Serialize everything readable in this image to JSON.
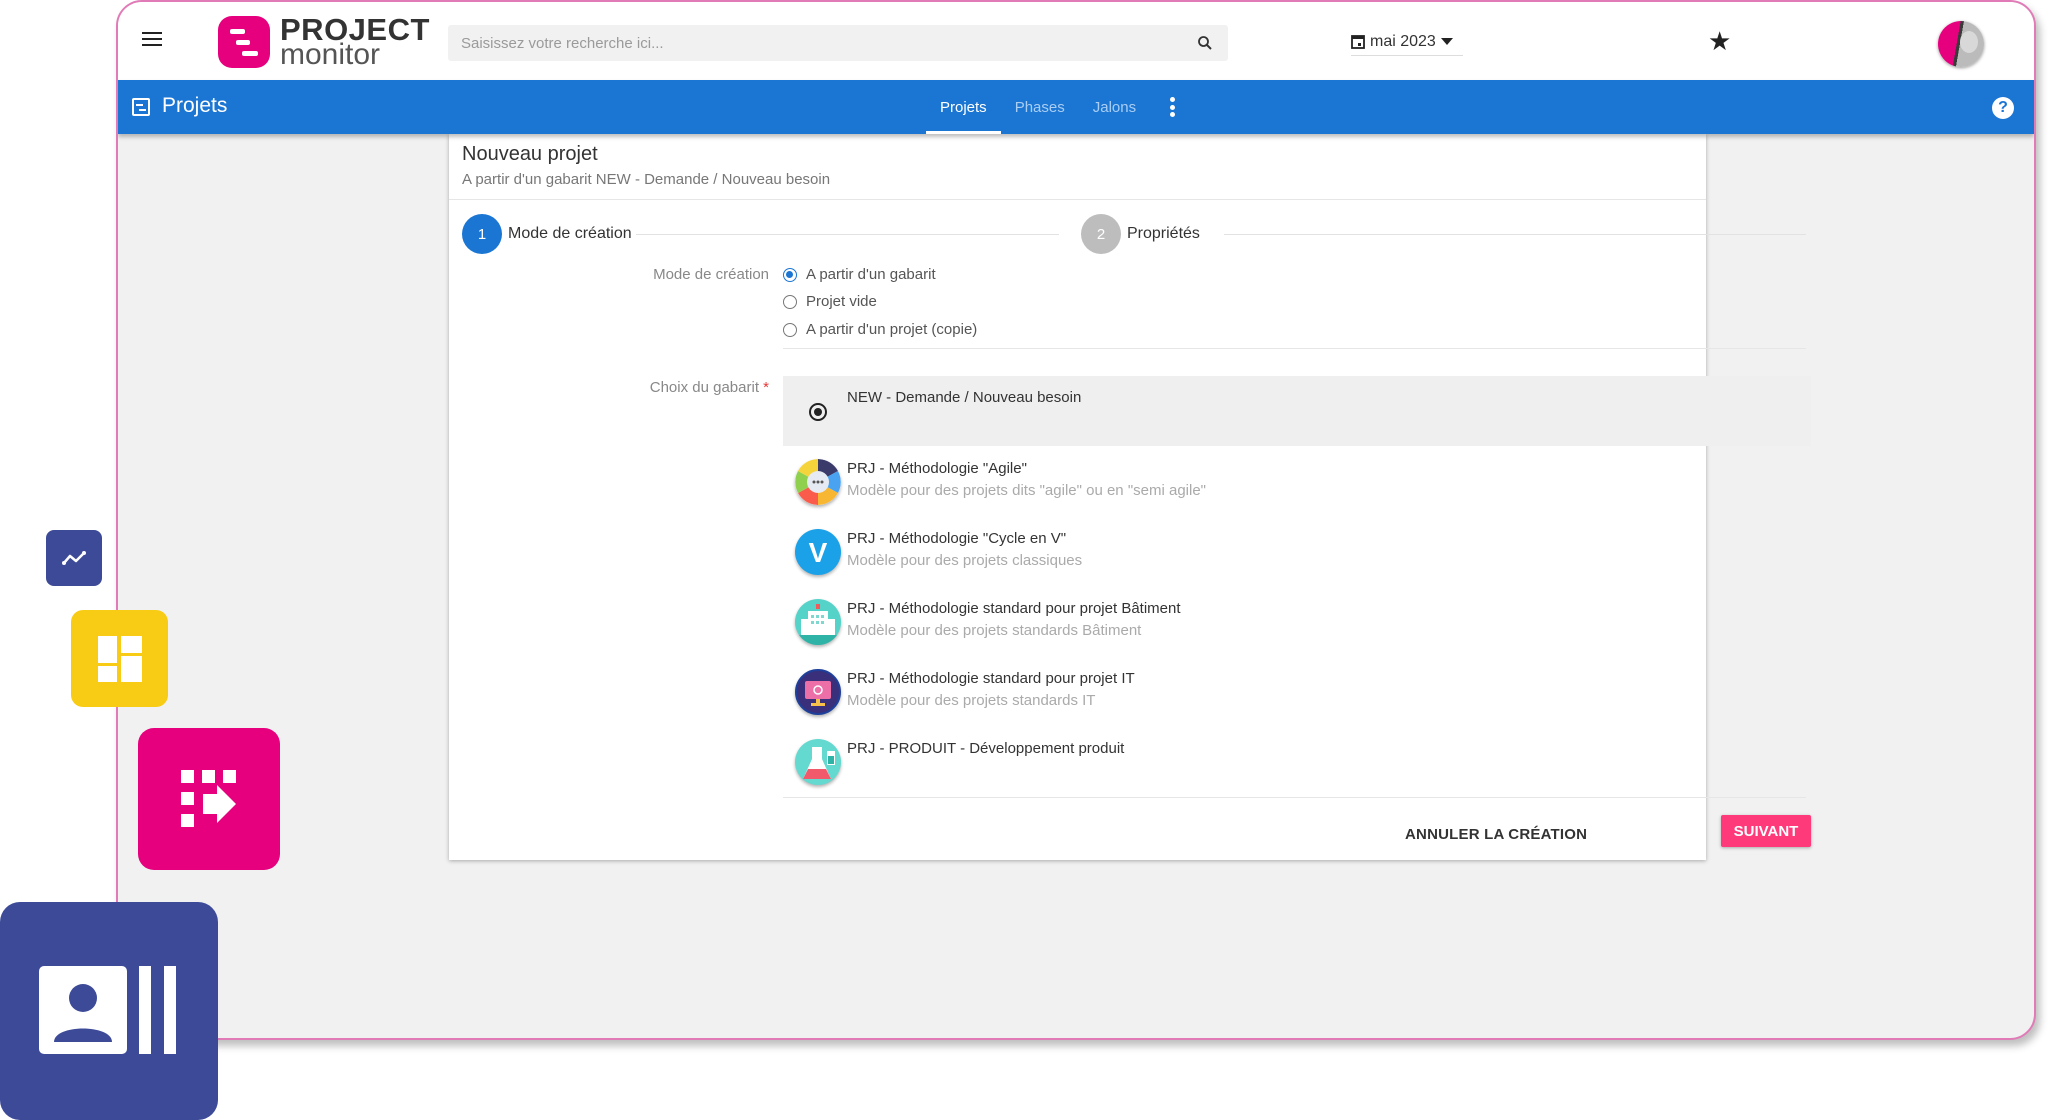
{
  "colors": {
    "brand_pink": "#e6007e",
    "primary_blue": "#1b76d3",
    "accent_button": "#fe3a7a",
    "indigo_tile": "#3c4a98",
    "yellow_tile": "#f8cb14",
    "step_inactive": "#bdbdbd"
  },
  "header": {
    "menu_icon": "hamburger-icon",
    "logo_line1": "PROJECT",
    "logo_line2": "monitor",
    "search_placeholder": "Saisissez votre recherche ici...",
    "search_value": "",
    "date_selector": "mai 2023",
    "favorites_icon": "star-icon",
    "avatar_icon": "user-avatar"
  },
  "nav": {
    "module_title": "Projets",
    "tabs": [
      {
        "label": "Projets",
        "active": true
      },
      {
        "label": "Phases",
        "active": false
      },
      {
        "label": "Jalons",
        "active": false
      }
    ],
    "more_icon": "more-vert-icon",
    "help_label": "?"
  },
  "form": {
    "title": "Nouveau projet",
    "subtitle": "A partir d'un gabarit NEW - Demande / Nouveau besoin",
    "steps": [
      {
        "number": "1",
        "label": "Mode de création",
        "active": true
      },
      {
        "number": "2",
        "label": "Propriétés",
        "active": false
      }
    ],
    "creation_mode": {
      "label": "Mode de création",
      "options": [
        {
          "label": "A partir d'un gabarit",
          "checked": true
        },
        {
          "label": "Projet vide",
          "checked": false
        },
        {
          "label": "A partir d'un projet (copie)",
          "checked": false
        }
      ]
    },
    "template_choice": {
      "label": "Choix du gabarit",
      "required_mark": "*",
      "items": [
        {
          "title": "NEW - Demande / Nouveau besoin",
          "description": "",
          "icon": "radio-selected",
          "selected": true
        },
        {
          "title": "PRJ - Méthodologie \"Agile\"",
          "description": "Modèle pour des projets dits \"agile\" ou en \"semi agile\"",
          "icon": "agile-cycle-icon",
          "selected": false
        },
        {
          "title": "PRJ - Méthodologie \"Cycle en V\"",
          "description": "Modèle pour des projets classiques",
          "icon": "v-cycle-icon",
          "selected": false
        },
        {
          "title": "PRJ - Méthodologie standard pour projet Bâtiment",
          "description": "Modèle pour des projets standards Bâtiment",
          "icon": "building-icon",
          "selected": false
        },
        {
          "title": "PRJ - Méthodologie standard pour projet IT",
          "description": "Modèle pour des projets standards IT",
          "icon": "monitor-icon",
          "selected": false
        },
        {
          "title": "PRJ - PRODUIT - Développement produit",
          "description": "",
          "icon": "lab-flask-icon",
          "selected": false
        }
      ]
    },
    "actions": {
      "cancel_label": "ANNULER LA CRÉATION",
      "next_label": "SUIVANT"
    }
  },
  "decorative_tiles": [
    {
      "icon": "trend-chart-icon"
    },
    {
      "icon": "dashboard-layout-icon"
    },
    {
      "icon": "grid-arrow-icon"
    },
    {
      "icon": "contact-card-icon"
    }
  ]
}
